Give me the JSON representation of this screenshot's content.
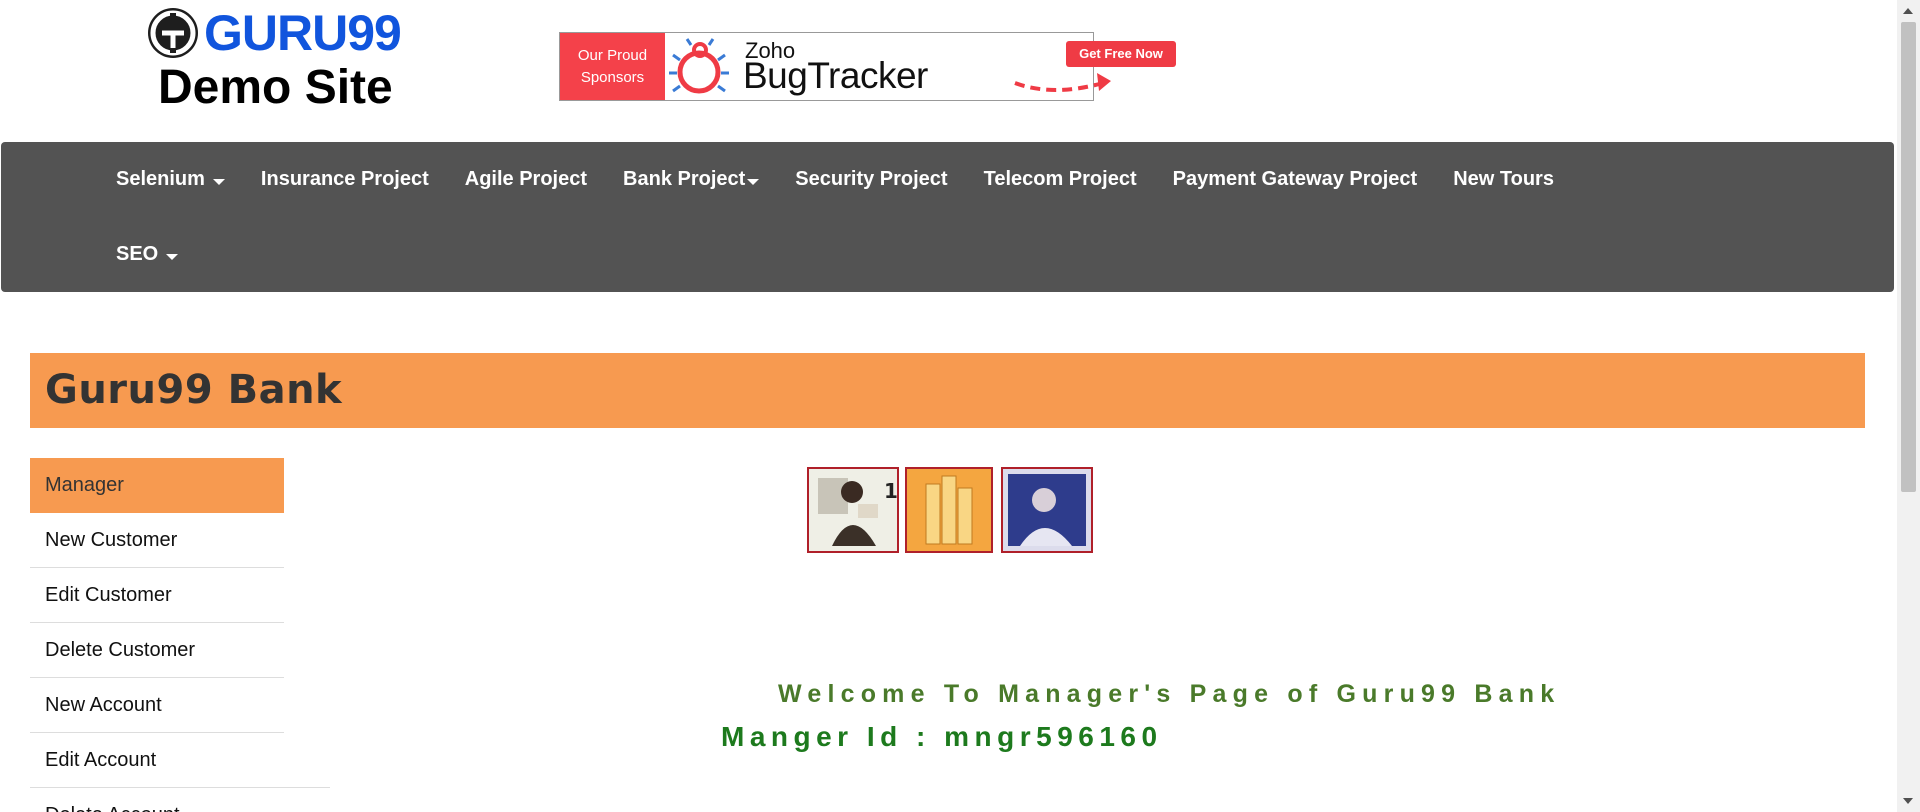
{
  "logo": {
    "brand": "GURU99",
    "subtitle": "Demo Site"
  },
  "sponsor": {
    "label_line1": "Our Proud",
    "label_line2": "Sponsors",
    "product_line1": "Zoho",
    "product_line2": "BugTracker",
    "cta": "Get Free Now"
  },
  "nav": {
    "row1": [
      {
        "label": "Selenium",
        "dropdown": true
      },
      {
        "label": "Insurance Project",
        "dropdown": false
      },
      {
        "label": "Agile Project",
        "dropdown": false
      },
      {
        "label": "Bank Project",
        "dropdown": true
      },
      {
        "label": "Security Project",
        "dropdown": false
      },
      {
        "label": "Telecom Project",
        "dropdown": false
      },
      {
        "label": "Payment Gateway Project",
        "dropdown": false
      },
      {
        "label": "New Tours",
        "dropdown": false
      }
    ],
    "row2": [
      {
        "label": "SEO",
        "dropdown": true
      }
    ]
  },
  "bank": {
    "title": "Guru99 Bank"
  },
  "menu": {
    "items": [
      {
        "label": "Manager",
        "active": true
      },
      {
        "label": "New Customer"
      },
      {
        "label": "Edit Customer"
      },
      {
        "label": "Delete Customer"
      },
      {
        "label": "New Account"
      },
      {
        "label": "Edit Account"
      },
      {
        "label": "Delete Account"
      }
    ]
  },
  "main": {
    "welcome": "Welcome To Manager's Page of Guru99 Bank",
    "manager_id": "Manger Id : mngr596160"
  },
  "colors": {
    "nav_bg": "#535353",
    "accent_orange": "#f79a50",
    "welcome_green": "#4a7a2a",
    "id_green": "#1d7a1d",
    "brand_blue": "#1155dd"
  }
}
